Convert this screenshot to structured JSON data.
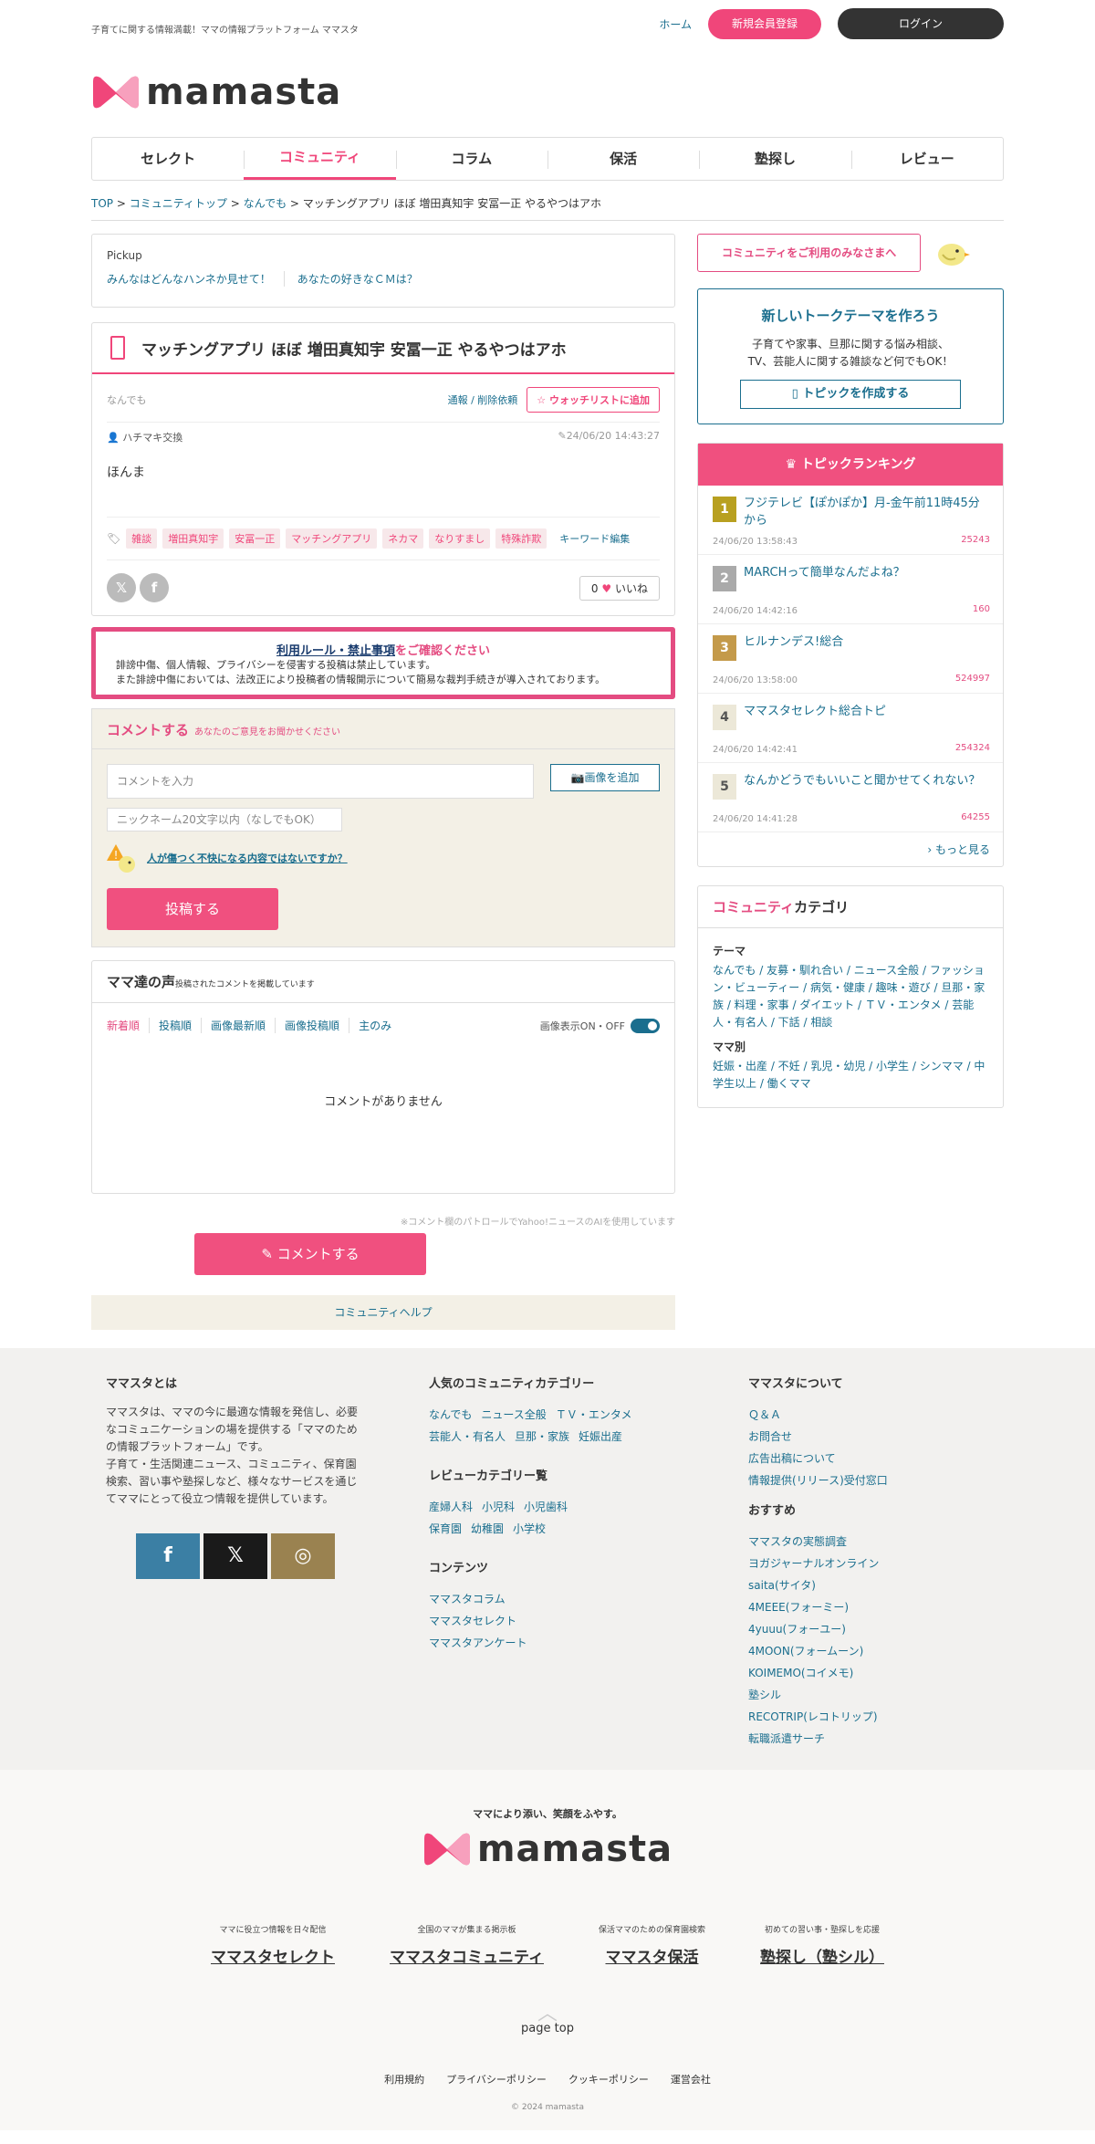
{
  "header": {
    "tagline": "子育てに関する情報満載！ママの情報プラットフォーム ママスタ",
    "home": "ホーム",
    "register": "新規会員登録",
    "login": "ログイン",
    "logo": "mamasta"
  },
  "nav": [
    "セレクト",
    "コミュニティ",
    "コラム",
    "保活",
    "塾探し",
    "レビュー"
  ],
  "breadcrumb": {
    "top": "TOP",
    "community": "コミュニティトップ",
    "category": "なんでも",
    "current": "マッチングアプリ ほぼ 増田真知宇 安冨一正 やるやつはアホ"
  },
  "pickup": {
    "label": "Pickup",
    "links": [
      "みんなはどんなハンネか見せて！",
      "あなたの好きなＣＭは？"
    ]
  },
  "topic": {
    "title": "マッチングアプリ ほぼ 増田真知宇 安冨一正 やるやつはアホ",
    "category": "なんでも",
    "report": "通報 / 削除依頼",
    "watch": "ウォッチリストに追加",
    "author": "ハチマキ交換",
    "date": "24/06/20 14:43:27",
    "body": "ほんま",
    "tags": [
      "雑談",
      "増田真知宇",
      "安冨一正",
      "マッチングアプリ",
      "ネカマ",
      "なりすまし",
      "特殊詐欺"
    ],
    "tag_edit": "キーワード編集",
    "like_count": "0",
    "like_label": "いいね"
  },
  "rules": {
    "title_link": "利用ルール・禁止事項",
    "title_rest": "をご確認ください",
    "line1": "誹謗中傷、個人情報、プライバシーを侵害する投稿は禁止しています。",
    "line2": "また誹謗中傷においては、法改正により投稿者の情報開示について簡易な裁判手続きが導入されております。"
  },
  "comment_form": {
    "title": "コメントする",
    "sub": "あなたのご意見をお聞かせください",
    "input_ph": "コメントを入力",
    "image_btn": "画像を追加",
    "nick_ph": "ニックネーム20文字以内（なしでもOK）",
    "warn": "人が傷つく不快になる内容ではないですか？",
    "post": "投稿する"
  },
  "voice": {
    "title": "ママ達の声",
    "sub": "投稿されたコメントを掲載しています",
    "sorts": [
      "新着順",
      "投稿順",
      "画像最新順",
      "画像投稿順",
      "主のみ"
    ],
    "toggle": "画像表示ON・OFF",
    "empty": "コメントがありません"
  },
  "note": "※コメント欄のパトロールでYahoo!ニュースのAIを使用しています",
  "comment_btn": "コメントする",
  "help": "コミュニティヘルプ",
  "side": {
    "welcome": "コミュニティをご利用のみなさまへ",
    "new_title": "新しいトークテーマを作ろう",
    "new_text1": "子育てや家事、旦那に関する悩み相談、",
    "new_text2": "TV、芸能人に関する雑談など何でもOK！",
    "new_btn": "トピックを作成する",
    "ranking_title": "トピックランキング",
    "ranking": [
      {
        "n": "1",
        "title": "フジテレビ【ぽかぽか】月-金午前11時45分から",
        "date": "24/06/20 13:58:43",
        "count": "25243",
        "color": "#b8a020"
      },
      {
        "n": "2",
        "title": "MARCHって簡単なんだよね？",
        "date": "24/06/20 14:42:16",
        "count": "160",
        "color": "#aaaaaa"
      },
      {
        "n": "3",
        "title": "ヒルナンデス!総合",
        "date": "24/06/20 13:58:00",
        "count": "524997",
        "color": "#c49a4a"
      },
      {
        "n": "4",
        "title": "ママスタセレクト総合トピ",
        "date": "24/06/20 14:42:41",
        "count": "254324",
        "color": "#ece8d8"
      },
      {
        "n": "5",
        "title": "なんかどうでもいいこと聞かせてくれない？",
        "date": "24/06/20 14:41:28",
        "count": "64255",
        "color": "#ece8d8"
      }
    ],
    "more": "もっと見る",
    "cat_title_p": "コミュニティ",
    "cat_title": "カテゴリ",
    "theme": "テーマ",
    "theme_list": "なんでも / 友募・馴れ合い / ニュース全般 / ファッション・ビューティー / 病気・健康 / 趣味・遊び / 旦那・家族 / 料理・家事 / ダイエット / ＴＶ・エンタメ / 芸能人・有名人 / 下話 / 相談",
    "mama": "ママ別",
    "mama_list": "妊娠・出産 / 不妊 / 乳児・幼児 / 小学生 / シンママ / 中学生以上 / 働くママ"
  },
  "footer": {
    "about_h": "ママスタとは",
    "about1": "ママスタは、ママの今に最適な情報を発信し、必要なコミュニケーションの場を提供する「ママのための情報プラットフォーム」です。",
    "about2": "子育て・生活関連ニュース、コミュニティ、保育園検索、習い事や塾探しなど、様々なサービスを通じてママにとって役立つ情報を提供しています。",
    "pop_h": "人気のコミュニティカテゴリー",
    "pop": [
      "なんでも",
      "ニュース全般",
      "ＴＶ・エンタメ",
      "芸能人・有名人",
      "旦那・家族",
      "妊娠出産"
    ],
    "rev_h": "レビューカテゴリー覧",
    "rev": [
      "産婦人科",
      "小児科",
      "小児歯科",
      "保育園",
      "幼稚園",
      "小学校"
    ],
    "con_h": "コンテンツ",
    "con": [
      "ママスタコラム",
      "ママスタセレクト",
      "ママスタアンケート"
    ],
    "ab_h": "ママスタについて",
    "ab": [
      "Ｑ＆Ａ",
      "お問合せ",
      "広告出稿について",
      "情報提供(リリース)受付窓口"
    ],
    "rec_h": "おすすめ",
    "rec": [
      "ママスタの実態調査",
      "ヨガジャーナルオンライン",
      "saita(サイタ)",
      "4MEEE(フォーミー)",
      "4yuuu(フォーユー)",
      "4MOON(フォームーン)",
      "KOIMEMO(コイメモ)",
      "塾シル",
      "RECOTRIP(レコトリップ)",
      "転職派遣サーチ"
    ],
    "catch": "ママにより添い、笑顔をふやす。",
    "sites": [
      {
        "s": "ママに役立つ情報を日々配信",
        "t": "ママスタセレクト"
      },
      {
        "s": "全国のママが集まる掲示板",
        "t": "ママスタコミュニティ"
      },
      {
        "s": "保活ママのための保育園検索",
        "t": "ママスタ保活"
      },
      {
        "s": "初めての習い事・塾探しを応援",
        "t": "塾探し（塾シル）"
      }
    ],
    "pagetop": "page top",
    "links": [
      "利用規約",
      "プライバシーポリシー",
      "クッキーポリシー",
      "運営会社"
    ],
    "copy": "© 2024 mamasta"
  }
}
